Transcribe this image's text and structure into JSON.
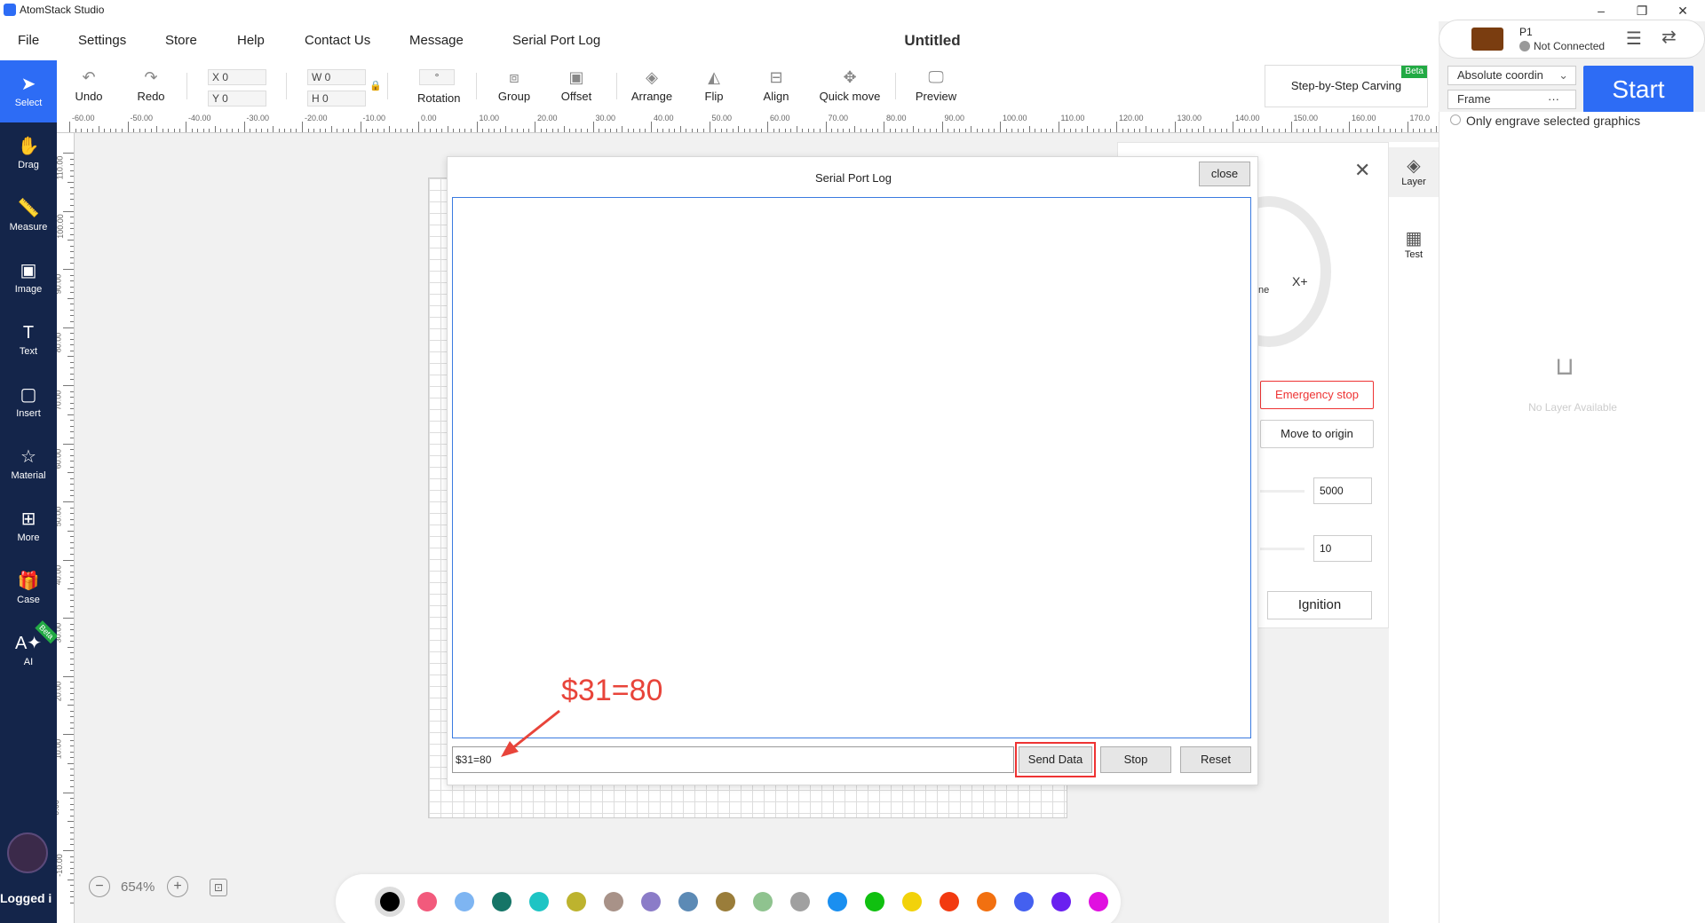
{
  "app": {
    "title": "AtomStack Studio"
  },
  "window_controls": {
    "minimize": "–",
    "restore": "❐",
    "close": "✕"
  },
  "menu": [
    "File",
    "Settings",
    "Store",
    "Help",
    "Contact Us",
    "Message",
    "Serial Port Log"
  ],
  "document": {
    "title": "Untitled"
  },
  "machine": {
    "name": "P1",
    "status": "Not Connected"
  },
  "toolbar": {
    "undo": "Undo",
    "redo": "Redo",
    "x_label": "X",
    "x_value": "0",
    "y_label": "Y",
    "y_value": "0",
    "w_label": "W",
    "w_value": "0",
    "h_label": "H",
    "h_value": "0",
    "rotation_value": "°",
    "rotation": "Rotation",
    "group": "Group",
    "offset": "Offset",
    "arrange": "Arrange",
    "flip": "Flip",
    "align": "Align",
    "quick_move": "Quick move",
    "preview": "Preview",
    "step_carving": "Step-by-Step Carving",
    "beta": "Beta"
  },
  "start": {
    "label": "Start",
    "coord_mode": "Absolute coordin",
    "frame": "Frame",
    "frame_more": "···",
    "only_selected": "Only engrave selected graphics"
  },
  "sidebar": [
    {
      "label": "Select",
      "icon": "cursor-icon"
    },
    {
      "label": "Drag",
      "icon": "hand-icon"
    },
    {
      "label": "Measure",
      "icon": "ruler-icon"
    },
    {
      "label": "Image",
      "icon": "image-icon"
    },
    {
      "label": "Text",
      "icon": "text-icon"
    },
    {
      "label": "Insert",
      "icon": "insert-icon"
    },
    {
      "label": "Material",
      "icon": "star-icon"
    },
    {
      "label": "More",
      "icon": "grid-icon"
    },
    {
      "label": "Case",
      "icon": "gift-icon"
    },
    {
      "label": "AI",
      "icon": "ai-icon"
    }
  ],
  "sidebar_extra": {
    "ai_badge": "Beta",
    "user_status": "Logged i"
  },
  "right_tabs": [
    {
      "label": "Layer"
    },
    {
      "label": "Test"
    }
  ],
  "layer_panel": {
    "empty": "No Layer Available"
  },
  "control_panel": {
    "x_plus": "X+",
    "home_partial": "ne",
    "emergency": "Emergency stop",
    "move_origin": "Move to origin",
    "speed": "5000",
    "power": "10",
    "ignition": "Ignition"
  },
  "dialog": {
    "title": "Serial Port Log",
    "close": "close",
    "input_value": "$31=80",
    "send": "Send Data",
    "stop": "Stop",
    "reset": "Reset",
    "annotation": "$31=80"
  },
  "zoom": {
    "value": "654%",
    "minus": "−",
    "plus": "+"
  },
  "ruler": {
    "top": [
      "-60.00",
      "-50.00",
      "-40.00",
      "-30.00",
      "-20.00",
      "-10.00",
      "0.00",
      "10.00",
      "20.00",
      "30.00",
      "40.00",
      "50.00",
      "60.00",
      "70.00",
      "80.00",
      "90.00",
      "100.00",
      "110.00",
      "120.00",
      "130.00",
      "140.00",
      "150.00",
      "160.00",
      "170.0"
    ],
    "left": [
      "110.00",
      "100.00",
      "90.00",
      "80.00",
      "70.00",
      "60.00",
      "50.00",
      "40.00",
      "30.00",
      "20.00",
      "10.00",
      "0.00",
      "-10.00"
    ]
  },
  "palette": [
    "#000000",
    "#f25a7c",
    "#7eb5f2",
    "#157567",
    "#1ec4c4",
    "#bdb32e",
    "#a89288",
    "#8b7cc8",
    "#5c8ab5",
    "#9a7d3a",
    "#8fc38f",
    "#a0a0a0",
    "#1a8ff0",
    "#10c010",
    "#f2d20a",
    "#f23a10",
    "#f27010",
    "#4460f0",
    "#6a20f0",
    "#e010e0"
  ]
}
